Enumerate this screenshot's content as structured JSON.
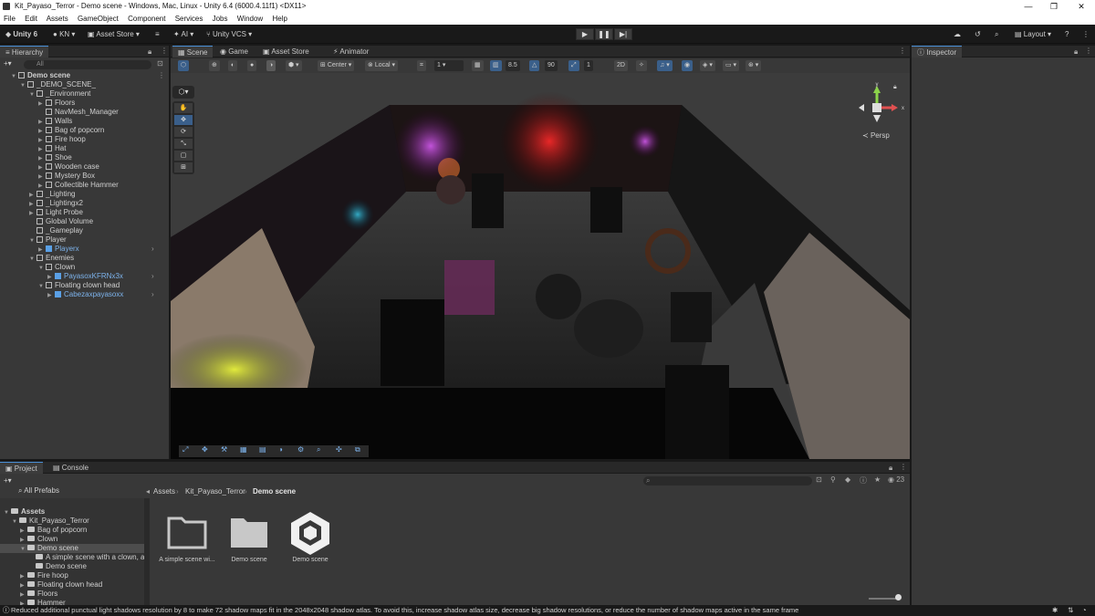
{
  "window": {
    "title": "Kit_Payaso_Terror - Demo scene - Windows, Mac, Linux - Unity 6.4 (6000.4.11f1) <DX11>"
  },
  "menu": [
    "File",
    "Edit",
    "Assets",
    "GameObject",
    "Component",
    "Services",
    "Jobs",
    "Window",
    "Help"
  ],
  "toolbar": {
    "unity_label": "Unity 6",
    "account": "KN",
    "asset_store": "Asset Store",
    "ai": "AI",
    "vcs": "Unity VCS",
    "layout": "Layout"
  },
  "tabs": {
    "hierarchy": "Hierarchy",
    "scene": "Scene",
    "game": "Game",
    "asset_store": "Asset Store",
    "animator": "Animator",
    "inspector": "Inspector",
    "project": "Project",
    "console": "Console"
  },
  "hierarchy": {
    "search_placeholder": "All",
    "items": [
      {
        "label": "Demo scene",
        "depth": 0,
        "type": "scene",
        "expanded": true
      },
      {
        "label": "_DEMO_SCENE_",
        "depth": 1,
        "type": "obj",
        "expanded": true
      },
      {
        "label": "_Environment",
        "depth": 2,
        "type": "obj",
        "expanded": true
      },
      {
        "label": "Floors",
        "depth": 3,
        "type": "obj",
        "arrow": true
      },
      {
        "label": "NavMesh_Manager",
        "depth": 3,
        "type": "obj"
      },
      {
        "label": "Walls",
        "depth": 3,
        "type": "obj",
        "arrow": true
      },
      {
        "label": "Bag of popcorn",
        "depth": 3,
        "type": "obj",
        "arrow": true
      },
      {
        "label": "Fire hoop",
        "depth": 3,
        "type": "obj",
        "arrow": true
      },
      {
        "label": "Hat",
        "depth": 3,
        "type": "obj",
        "arrow": true
      },
      {
        "label": "Shoe",
        "depth": 3,
        "type": "obj",
        "arrow": true
      },
      {
        "label": "Wooden case",
        "depth": 3,
        "type": "obj",
        "arrow": true
      },
      {
        "label": "Mystery Box",
        "depth": 3,
        "type": "obj",
        "arrow": true
      },
      {
        "label": "Collectible Hammer",
        "depth": 3,
        "type": "obj",
        "arrow": true
      },
      {
        "label": "_Lighting",
        "depth": 2,
        "type": "obj",
        "arrow": true
      },
      {
        "label": "_Lightingx2",
        "depth": 2,
        "type": "obj",
        "arrow": true
      },
      {
        "label": "Light Probe",
        "depth": 2,
        "type": "obj",
        "arrow": true
      },
      {
        "label": "Global Volume",
        "depth": 2,
        "type": "obj"
      },
      {
        "label": "_Gameplay",
        "depth": 2,
        "type": "obj"
      },
      {
        "label": "Player",
        "depth": 2,
        "type": "obj",
        "expanded": true
      },
      {
        "label": "Playerx",
        "depth": 3,
        "type": "prefab",
        "arrow": true
      },
      {
        "label": "Enemies",
        "depth": 2,
        "type": "obj",
        "expanded": true
      },
      {
        "label": "Clown",
        "depth": 3,
        "type": "obj",
        "expanded": true
      },
      {
        "label": "PayasoxKFRNx3x",
        "depth": 4,
        "type": "prefab",
        "arrow": true
      },
      {
        "label": "Floating clown head",
        "depth": 3,
        "type": "obj",
        "expanded": true
      },
      {
        "label": "Cabezaxpayasoxx",
        "depth": 4,
        "type": "prefab",
        "arrow": true
      }
    ]
  },
  "scene_toolbar": {
    "pivot": "Center",
    "space": "Local",
    "grid_val": "1",
    "snap_val": "8.5",
    "rot_val": "90",
    "scale_val": "1"
  },
  "gizmo": {
    "persp": "Persp"
  },
  "project": {
    "breadcrumb": [
      "Assets",
      "Kit_Payaso_Terror",
      "Demo scene"
    ],
    "all_prefabs": "All Prefabs",
    "count": "23",
    "tree": [
      {
        "label": "Assets",
        "depth": 0
      },
      {
        "label": "Kit_Payaso_Terror",
        "depth": 1
      },
      {
        "label": "Bag of popcorn",
        "depth": 2
      },
      {
        "label": "Clown",
        "depth": 2
      },
      {
        "label": "Demo scene",
        "depth": 2,
        "selected": true
      },
      {
        "label": "A simple scene with a clown, a",
        "depth": 3
      },
      {
        "label": "Demo scene",
        "depth": 3
      },
      {
        "label": "Fire hoop",
        "depth": 2
      },
      {
        "label": "Floating clown head",
        "depth": 2
      },
      {
        "label": "Floors",
        "depth": 2
      },
      {
        "label": "Hammer",
        "depth": 2
      }
    ],
    "assets": [
      {
        "label": "A simple scene wi...",
        "kind": "folder-outline"
      },
      {
        "label": "Demo scene",
        "kind": "folder-filled"
      },
      {
        "label": "Demo scene",
        "kind": "unity-scene"
      }
    ]
  },
  "status": {
    "message": "Reduced additional punctual light shadows resolution by 8 to make 72 shadow maps fit in the 2048x2048 shadow atlas. To avoid this, increase shadow atlas size, decrease big shadow resolutions, or reduce the number of shadow maps active in the same frame"
  }
}
